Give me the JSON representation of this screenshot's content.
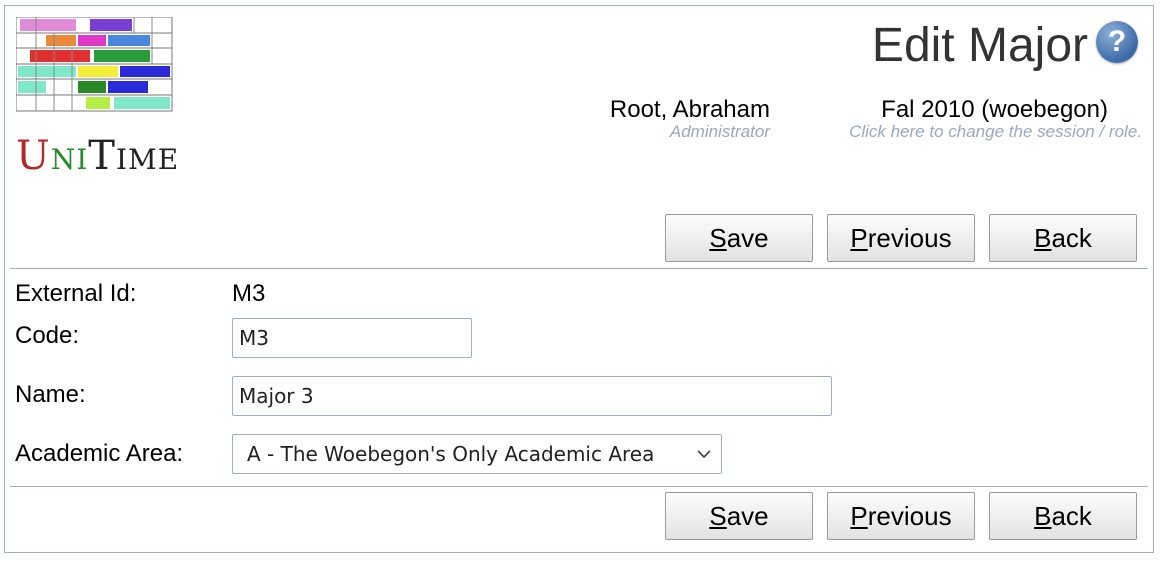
{
  "header": {
    "title": "Edit Major",
    "help_icon": "question-mark-icon",
    "logo": {
      "letter_u": "U",
      "letters_ni": "NI",
      "letter_t": "T",
      "letters_ime": "IME"
    },
    "user": {
      "name": "Root, Abraham",
      "role": "Administrator"
    },
    "session": {
      "name": "Fal 2010 (woebegon)",
      "hint": "Click here to change the session / role."
    }
  },
  "buttons": {
    "save": {
      "mnemonic": "S",
      "rest": "ave"
    },
    "previous": {
      "mnemonic": "P",
      "rest": "revious"
    },
    "back": {
      "mnemonic": "B",
      "rest": "ack"
    }
  },
  "form": {
    "external_id": {
      "label": "External Id:",
      "value": "M3"
    },
    "code": {
      "label": "Code:",
      "value": "M3"
    },
    "name": {
      "label": "Name:",
      "value": "Major 3"
    },
    "academic_area": {
      "label": "Academic Area:",
      "selected": "A - The Woebegon's Only Academic Area"
    }
  }
}
